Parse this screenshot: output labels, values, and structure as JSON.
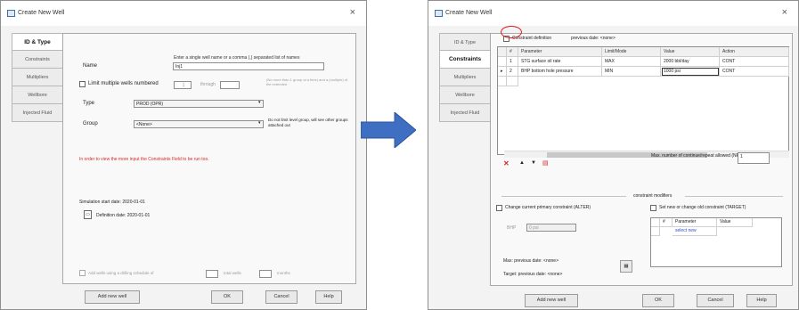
{
  "left": {
    "title": "Create New Well",
    "close": "×",
    "sidebar": [
      "ID & Type",
      "Constraints",
      "Multipliers",
      "Wellbore",
      "Injected Fluid"
    ],
    "instruction": "Enter a single well name or a comma (,) separated list of names",
    "name_label": "Name",
    "name_value": "Inj1",
    "multi_label": "Limit multiple wells numbered",
    "multi_spin": "1",
    "multi_mid": "through",
    "multi_note": "(No more than 1 group at a time) and a (multiple) of the extended",
    "type_label": "Type",
    "type_value": "PROD (OPR)",
    "group_label": "Group",
    "group_value": "<None>",
    "group_note": "Do not limit level group, will see other groups attached out",
    "warning": "In order to view the more input the Constraints Field to be run too.",
    "sim_start": "Simulation start date: 2020-01-01",
    "def_date": "Definition date: 2020-01-01",
    "bottom_check": "Add wells using a drilling schedule of",
    "bottom_mid": "total wells",
    "bottom_right": "months",
    "add_btn": "Add new well",
    "ok": "OK",
    "cancel": "Cancel",
    "help": "Help"
  },
  "right": {
    "title": "Create New Well",
    "close": "×",
    "sidebar": [
      "ID & Type",
      "Constraints",
      "Multipliers",
      "Wellbore",
      "Injected Fluid"
    ],
    "constraint_chk": "Constraint definition",
    "prev_date": "previous date: <none>",
    "grid_headers": [
      "#",
      "Parameter",
      "Limit/Mode",
      "Value",
      "Action"
    ],
    "grid_rows": [
      {
        "num": "1",
        "param": "STG surface oil rate",
        "mode": "MAX",
        "value": "2000 bbl/day",
        "action": "CONT"
      },
      {
        "num": "2",
        "param": "BHP bottom hole pressure",
        "mode": "MIN",
        "value": "1000 psi",
        "action": "CONT"
      }
    ],
    "max_label": "Max. number of continue/repeat allowed (NREPMAX):",
    "max_value": "1",
    "section_title": "constraint modifiers",
    "change_current": "Change current primary constraint (ALTER)",
    "set_new": "Set new or change old constraint (TARGET)",
    "bhp_label": "BHP",
    "bhp_value": "0 psi",
    "sub_headers": [
      "#",
      "Parameter",
      "Value"
    ],
    "sub_row": "select new",
    "max_line": "Max:   previous date: <none>",
    "target_line": "Target:  previous date: <none>",
    "add_btn": "Add new well",
    "ok": "OK",
    "cancel": "Cancel",
    "help": "Help"
  },
  "colors": {
    "accent": "#3f6fc2",
    "highlight": "#e01818",
    "warning": "#d42a2a"
  }
}
